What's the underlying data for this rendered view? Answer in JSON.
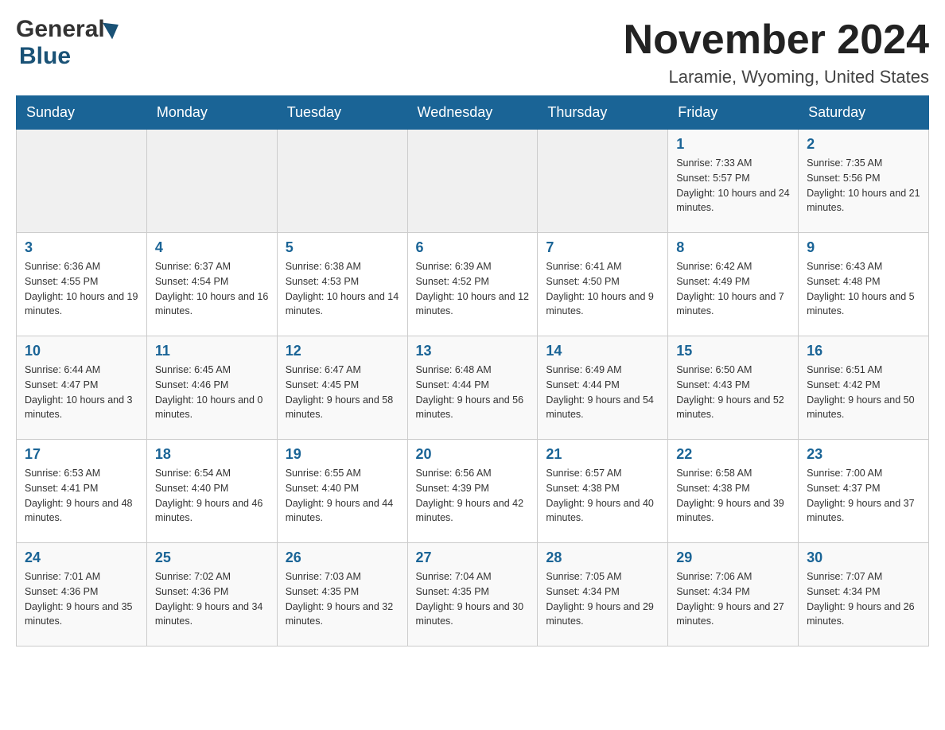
{
  "logo": {
    "general": "General",
    "blue": "Blue"
  },
  "header": {
    "title": "November 2024",
    "subtitle": "Laramie, Wyoming, United States"
  },
  "weekdays": [
    "Sunday",
    "Monday",
    "Tuesday",
    "Wednesday",
    "Thursday",
    "Friday",
    "Saturday"
  ],
  "weeks": [
    [
      {
        "day": "",
        "info": ""
      },
      {
        "day": "",
        "info": ""
      },
      {
        "day": "",
        "info": ""
      },
      {
        "day": "",
        "info": ""
      },
      {
        "day": "",
        "info": ""
      },
      {
        "day": "1",
        "info": "Sunrise: 7:33 AM\nSunset: 5:57 PM\nDaylight: 10 hours and 24 minutes."
      },
      {
        "day": "2",
        "info": "Sunrise: 7:35 AM\nSunset: 5:56 PM\nDaylight: 10 hours and 21 minutes."
      }
    ],
    [
      {
        "day": "3",
        "info": "Sunrise: 6:36 AM\nSunset: 4:55 PM\nDaylight: 10 hours and 19 minutes."
      },
      {
        "day": "4",
        "info": "Sunrise: 6:37 AM\nSunset: 4:54 PM\nDaylight: 10 hours and 16 minutes."
      },
      {
        "day": "5",
        "info": "Sunrise: 6:38 AM\nSunset: 4:53 PM\nDaylight: 10 hours and 14 minutes."
      },
      {
        "day": "6",
        "info": "Sunrise: 6:39 AM\nSunset: 4:52 PM\nDaylight: 10 hours and 12 minutes."
      },
      {
        "day": "7",
        "info": "Sunrise: 6:41 AM\nSunset: 4:50 PM\nDaylight: 10 hours and 9 minutes."
      },
      {
        "day": "8",
        "info": "Sunrise: 6:42 AM\nSunset: 4:49 PM\nDaylight: 10 hours and 7 minutes."
      },
      {
        "day": "9",
        "info": "Sunrise: 6:43 AM\nSunset: 4:48 PM\nDaylight: 10 hours and 5 minutes."
      }
    ],
    [
      {
        "day": "10",
        "info": "Sunrise: 6:44 AM\nSunset: 4:47 PM\nDaylight: 10 hours and 3 minutes."
      },
      {
        "day": "11",
        "info": "Sunrise: 6:45 AM\nSunset: 4:46 PM\nDaylight: 10 hours and 0 minutes."
      },
      {
        "day": "12",
        "info": "Sunrise: 6:47 AM\nSunset: 4:45 PM\nDaylight: 9 hours and 58 minutes."
      },
      {
        "day": "13",
        "info": "Sunrise: 6:48 AM\nSunset: 4:44 PM\nDaylight: 9 hours and 56 minutes."
      },
      {
        "day": "14",
        "info": "Sunrise: 6:49 AM\nSunset: 4:44 PM\nDaylight: 9 hours and 54 minutes."
      },
      {
        "day": "15",
        "info": "Sunrise: 6:50 AM\nSunset: 4:43 PM\nDaylight: 9 hours and 52 minutes."
      },
      {
        "day": "16",
        "info": "Sunrise: 6:51 AM\nSunset: 4:42 PM\nDaylight: 9 hours and 50 minutes."
      }
    ],
    [
      {
        "day": "17",
        "info": "Sunrise: 6:53 AM\nSunset: 4:41 PM\nDaylight: 9 hours and 48 minutes."
      },
      {
        "day": "18",
        "info": "Sunrise: 6:54 AM\nSunset: 4:40 PM\nDaylight: 9 hours and 46 minutes."
      },
      {
        "day": "19",
        "info": "Sunrise: 6:55 AM\nSunset: 4:40 PM\nDaylight: 9 hours and 44 minutes."
      },
      {
        "day": "20",
        "info": "Sunrise: 6:56 AM\nSunset: 4:39 PM\nDaylight: 9 hours and 42 minutes."
      },
      {
        "day": "21",
        "info": "Sunrise: 6:57 AM\nSunset: 4:38 PM\nDaylight: 9 hours and 40 minutes."
      },
      {
        "day": "22",
        "info": "Sunrise: 6:58 AM\nSunset: 4:38 PM\nDaylight: 9 hours and 39 minutes."
      },
      {
        "day": "23",
        "info": "Sunrise: 7:00 AM\nSunset: 4:37 PM\nDaylight: 9 hours and 37 minutes."
      }
    ],
    [
      {
        "day": "24",
        "info": "Sunrise: 7:01 AM\nSunset: 4:36 PM\nDaylight: 9 hours and 35 minutes."
      },
      {
        "day": "25",
        "info": "Sunrise: 7:02 AM\nSunset: 4:36 PM\nDaylight: 9 hours and 34 minutes."
      },
      {
        "day": "26",
        "info": "Sunrise: 7:03 AM\nSunset: 4:35 PM\nDaylight: 9 hours and 32 minutes."
      },
      {
        "day": "27",
        "info": "Sunrise: 7:04 AM\nSunset: 4:35 PM\nDaylight: 9 hours and 30 minutes."
      },
      {
        "day": "28",
        "info": "Sunrise: 7:05 AM\nSunset: 4:34 PM\nDaylight: 9 hours and 29 minutes."
      },
      {
        "day": "29",
        "info": "Sunrise: 7:06 AM\nSunset: 4:34 PM\nDaylight: 9 hours and 27 minutes."
      },
      {
        "day": "30",
        "info": "Sunrise: 7:07 AM\nSunset: 4:34 PM\nDaylight: 9 hours and 26 minutes."
      }
    ]
  ],
  "colors": {
    "header_bg": "#1a6496",
    "header_text": "#ffffff",
    "day_number": "#1a6496",
    "border": "#cccccc"
  }
}
